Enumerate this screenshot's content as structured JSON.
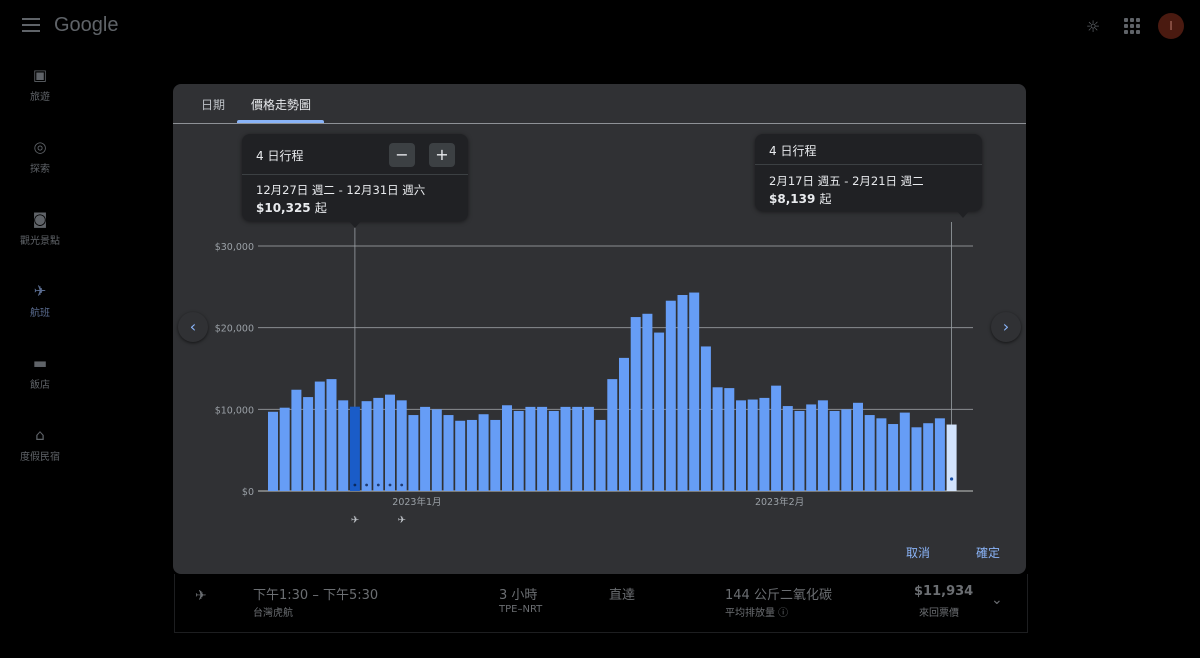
{
  "app": {
    "logo": "Google",
    "avatar_initial": "I"
  },
  "sidenav": [
    {
      "label": "旅遊",
      "icon": "suitcase-icon",
      "glyph": "▣"
    },
    {
      "label": "探索",
      "icon": "explore-icon",
      "glyph": "◎"
    },
    {
      "label": "觀光景點",
      "icon": "camera-icon",
      "glyph": "◙"
    },
    {
      "label": "航班",
      "icon": "airplane-icon",
      "glyph": "✈"
    },
    {
      "label": "飯店",
      "icon": "hotel-icon",
      "glyph": "▬"
    },
    {
      "label": "度假民宿",
      "icon": "house-icon",
      "glyph": "⌂"
    }
  ],
  "background_flight": {
    "time": "下午1:30 – 下午5:30",
    "airline": "台灣虎航",
    "duration": "3 小時",
    "route": "TPE–NRT",
    "stops": "直達",
    "emissions": "144 公斤二氧化碳",
    "emissions_sub": "平均排放量 ⓘ",
    "price": "$11,934",
    "price_sub": "來回票價"
  },
  "modal": {
    "tabs": [
      "日期",
      "價格走勢圖"
    ],
    "active_tab": "價格走勢圖",
    "selected_tip": {
      "trip_label": "4 日行程",
      "dates": "12月27日 週二 - 12月31日 週六",
      "price": "$10,325",
      "price_suffix": "起",
      "minus": "−",
      "plus": "+"
    },
    "hover_tip": {
      "trip_label": "4 日行程",
      "dates": "2月17日 週五 - 2月21日 週二",
      "price": "$8,139",
      "price_suffix": "起"
    },
    "prev_glyph": "‹",
    "next_glyph": "›",
    "cancel": "取消",
    "confirm": "確定",
    "depart_glyph": "✈",
    "return_glyph": "✈"
  },
  "chart_data": {
    "type": "bar",
    "ylabel_ticks": [
      "$0",
      "$10,000",
      "$20,000",
      "$30,000"
    ],
    "yticks": [
      0,
      10000,
      20000,
      30000
    ],
    "ylim": [
      0,
      30000
    ],
    "x_month_labels": [
      {
        "label": "2023年1月",
        "index": 7
      },
      {
        "label": "2023年2月",
        "index": 38
      }
    ],
    "selected_index": 7,
    "hover_index": 58,
    "range_dots": [
      7,
      8,
      9,
      10,
      11
    ],
    "values": [
      9700,
      10200,
      12400,
      11500,
      13400,
      13700,
      11100,
      10325,
      11000,
      11400,
      11800,
      11100,
      9300,
      10300,
      10000,
      9300,
      8600,
      8700,
      9400,
      8700,
      10500,
      9800,
      10300,
      10300,
      9800,
      10300,
      10300,
      10300,
      8700,
      13700,
      16300,
      21300,
      21700,
      19400,
      23300,
      24000,
      24300,
      17700,
      12700,
      12600,
      11100,
      11200,
      11400,
      12900,
      10400,
      9800,
      10600,
      11100,
      9800,
      10000,
      10800,
      9300,
      8900,
      8200,
      9600,
      7800,
      8300,
      8900,
      8139
    ],
    "colors": {
      "bar": "#669df6",
      "selected": "#1a5cc8",
      "hover": "#d2e3fc",
      "grid": "#9aa0a6"
    }
  }
}
